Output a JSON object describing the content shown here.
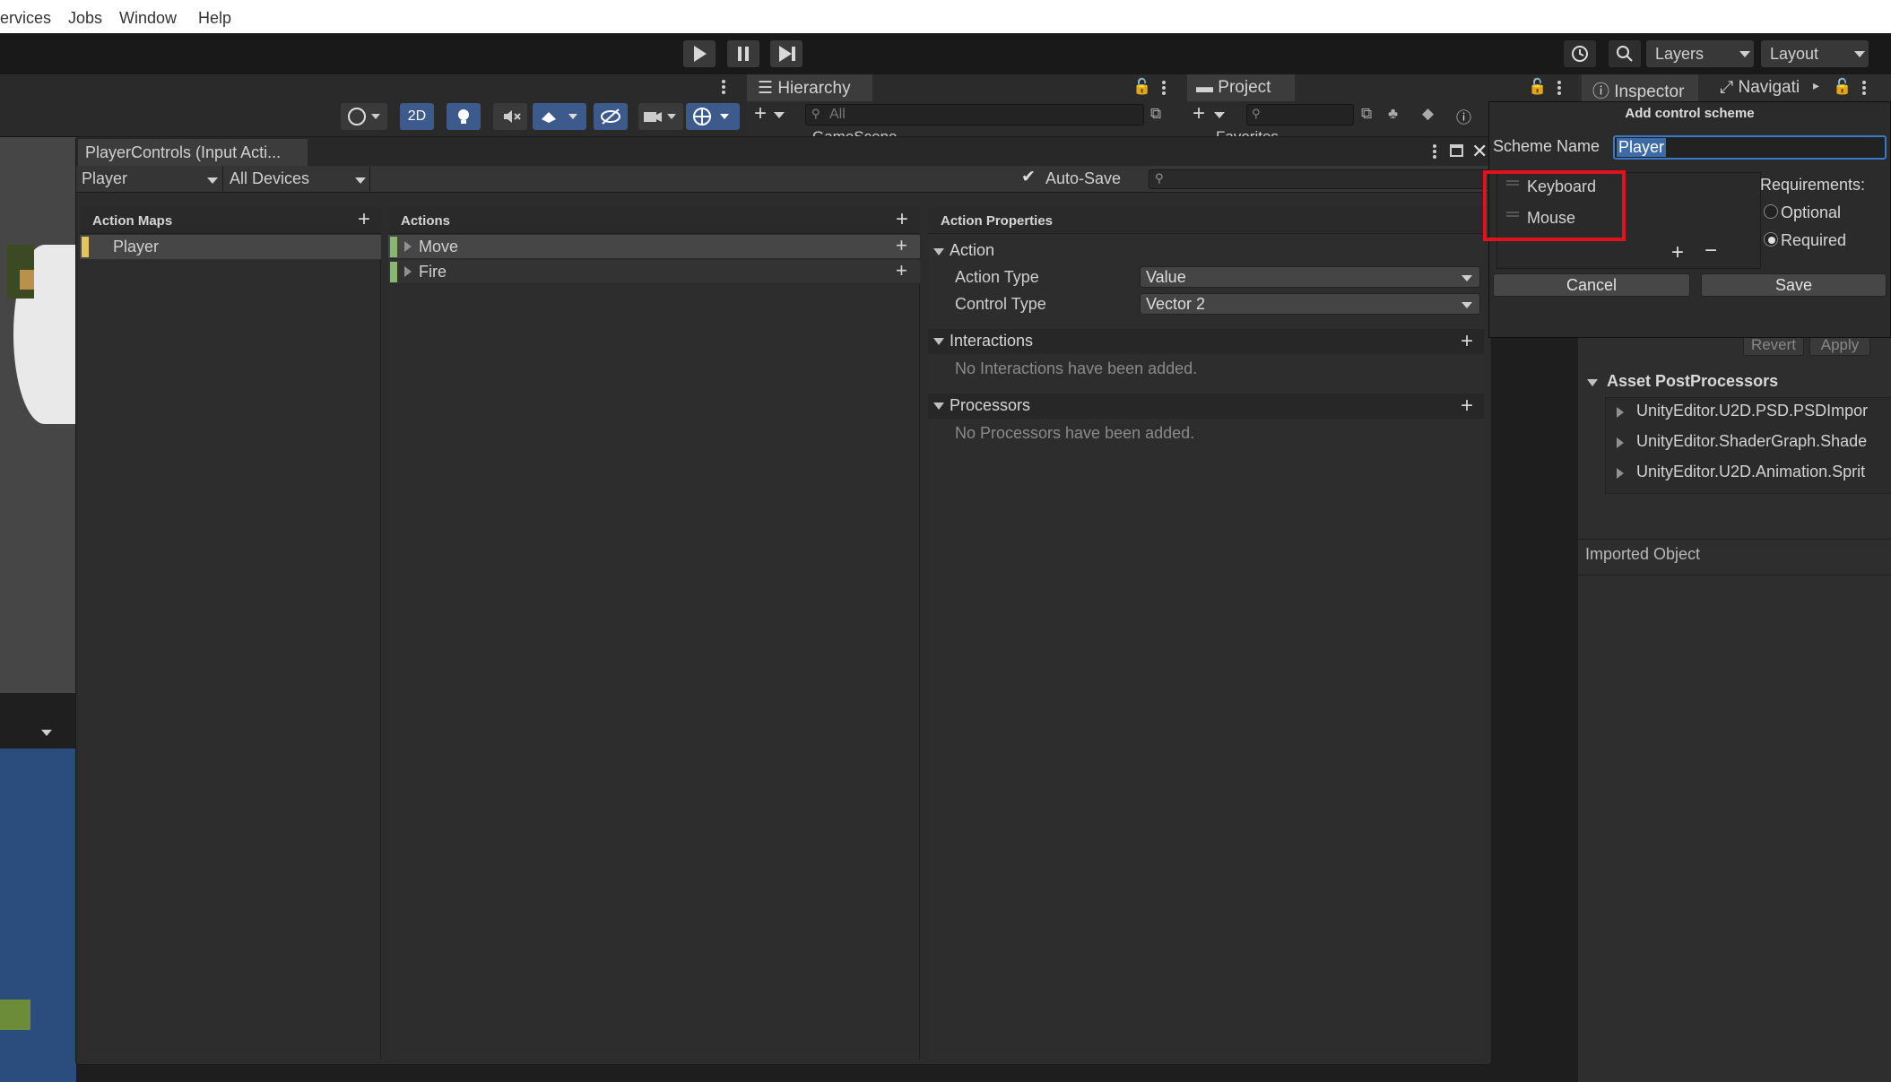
{
  "menu": [
    "ervices",
    "Jobs",
    "Window",
    "Help"
  ],
  "toolbar": {
    "layers": "Layers",
    "layout": "Layout"
  },
  "scene": {
    "mode_2d": "2D"
  },
  "hierarchy": {
    "tab": "Hierarchy",
    "search_placeholder": "All",
    "scene_name": "GameScene"
  },
  "project": {
    "tab": "Project",
    "favorites": "Favorites"
  },
  "inspector": {
    "tab": "Inspector",
    "tab2": "Navigati",
    "revert": "Revert",
    "apply": "Apply",
    "section": "Asset PostProcessors",
    "items": [
      "UnityEditor.U2D.PSD.PSDImpor",
      "UnityEditor.ShaderGraph.Shade",
      "UnityEditor.U2D.Animation.Sprit"
    ],
    "imported": "Imported Object"
  },
  "window": {
    "title": "PlayerControls (Input Acti...",
    "scheme_dropdown": "Player",
    "device_dropdown": "All Devices",
    "autosave_label": "Auto-Save",
    "autosave_checked": true,
    "action_maps_header": "Action Maps",
    "action_maps": [
      "Player"
    ],
    "actions_header": "Actions",
    "actions": [
      "Move",
      "Fire"
    ],
    "properties_header": "Action Properties",
    "action_section": "Action",
    "action_type_label": "Action Type",
    "action_type_value": "Value",
    "control_type_label": "Control Type",
    "control_type_value": "Vector 2",
    "interactions_section": "Interactions",
    "interactions_empty": "No Interactions have been added.",
    "processors_section": "Processors",
    "processors_empty": "No Processors have been added."
  },
  "popup": {
    "title": "Add control scheme",
    "scheme_name_label": "Scheme Name",
    "scheme_name_value": "Player",
    "devices": [
      "Keyboard",
      "Mouse"
    ],
    "requirements_label": "Requirements:",
    "optional": "Optional",
    "required": "Required",
    "selected_requirement": "Required",
    "cancel": "Cancel",
    "save": "Save"
  },
  "colors": {
    "highlight_box": "#e0131c",
    "selection_blue": "#3e6aa8",
    "action_map_accent": "#e6c45a",
    "action_accent": "#86b86e"
  }
}
